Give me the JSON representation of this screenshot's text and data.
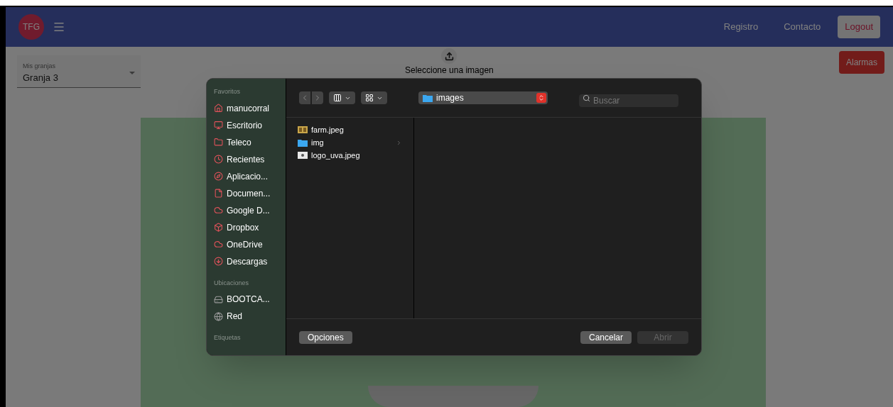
{
  "navbar": {
    "logo": "TFG",
    "links": [
      "Registro",
      "Contacto"
    ],
    "logout": "Logout"
  },
  "farm_select": {
    "label": "Mis granjas",
    "value": "Granja 3"
  },
  "upload": {
    "label": "Seleccione una imagen"
  },
  "alarms_button": "Alarmas",
  "file_dialog": {
    "sidebar": [
      {
        "title": "Favoritos",
        "items": [
          {
            "label": "manucorral"
          },
          {
            "label": "Escritorio"
          },
          {
            "label": "Teleco"
          },
          {
            "label": "Recientes"
          },
          {
            "label": "Aplicacio..."
          },
          {
            "label": "Documen..."
          },
          {
            "label": "Google D..."
          },
          {
            "label": "Dropbox"
          },
          {
            "label": "OneDrive"
          },
          {
            "label": "Descargas"
          }
        ]
      },
      {
        "title": "Ubicaciones",
        "items": [
          {
            "label": "BOOTCA..."
          },
          {
            "label": "Red"
          }
        ]
      },
      {
        "title": "Etiquetas"
      }
    ],
    "location": "images",
    "search": {
      "placeholder": "Buscar"
    },
    "files": [
      {
        "name": "farm.jpeg",
        "kind": "photo"
      },
      {
        "name": "img",
        "kind": "folder"
      },
      {
        "name": "logo_uva.jpeg",
        "kind": "image"
      }
    ],
    "options_button": "Opciones",
    "cancel_button": "Cancelar",
    "open_button": {
      "label": "Abrir",
      "disabled": true
    }
  }
}
